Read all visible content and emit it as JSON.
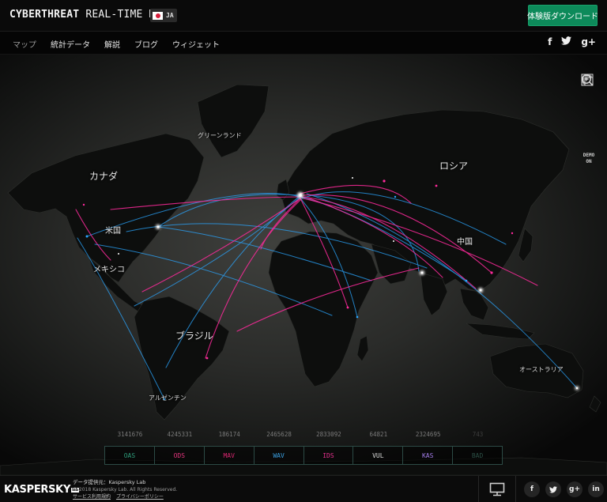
{
  "header": {
    "title_bold": "CYBERTHREAT",
    "title_light": "REAL-TIME MAP",
    "language": "JA",
    "trial_button": "体験版ダウンロード"
  },
  "nav": {
    "items": [
      "マップ",
      "統計データ",
      "解説",
      "ブログ",
      "ウィジェット"
    ],
    "active_index": 0,
    "social": [
      "f",
      "t",
      "g+"
    ]
  },
  "map": {
    "labels": {
      "canada": "カナダ",
      "greenland": "グリーンランド",
      "russia": "ロシア",
      "usa": "米国",
      "mexico": "メキシコ",
      "china": "中国",
      "brazil": "ブラジル",
      "argentina": "アルゼンチン",
      "australia": "オーストラリア"
    },
    "tools": [
      "grid-icon",
      "layers-icon",
      "zoom-in-icon",
      "zoom-out-icon"
    ],
    "demo_line1": "DEMO",
    "demo_line2": "ON",
    "colors": {
      "pink": "#ff2a9c",
      "blue": "#2aa6ff",
      "land": "#0d0e0d"
    }
  },
  "counters": [
    {
      "label": "OAS",
      "count": "3141676",
      "color": "#2e9b7a"
    },
    {
      "label": "ODS",
      "count": "4245331",
      "color": "#e2357d"
    },
    {
      "label": "MAV",
      "count": "186174",
      "color": "#d8266f"
    },
    {
      "label": "WAV",
      "count": "2465628",
      "color": "#3a9ee0"
    },
    {
      "label": "IDS",
      "count": "2833092",
      "color": "#e6318d"
    },
    {
      "label": "VUL",
      "count": "64821",
      "color": "#dedede"
    },
    {
      "label": "KAS",
      "count": "2324695",
      "color": "#a27ce8"
    },
    {
      "label": "BAD",
      "count": "743",
      "color": "#2c4f46"
    }
  ],
  "footer": {
    "logo": "KASPERSKY",
    "logo_lab": "lab",
    "source_label": "データ提供元：Kaspersky Lab",
    "copyright": "© 2018 Kaspersky Lab. All Rights Reserved.",
    "terms_link": "サービス利用規約",
    "privacy_link": "プライバシーポリシー",
    "social": [
      "f",
      "t",
      "g+",
      "in"
    ]
  }
}
